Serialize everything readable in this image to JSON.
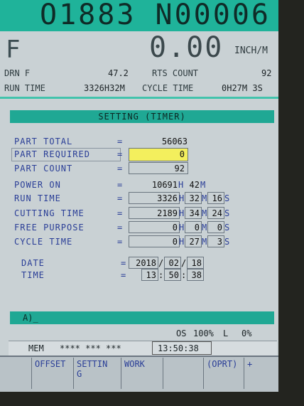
{
  "header": {
    "program_number": "O1883 N00006",
    "mode": "F",
    "feed_value": "0.00",
    "feed_unit": "INCH/M"
  },
  "status": {
    "drn_label": "DRN F",
    "drn_value": "47.2",
    "parts_count_label": "RTS COUNT",
    "parts_count_value": "92",
    "run_time_label": "RUN TIME",
    "run_time_value": "3326H32M",
    "cycle_time_label": "CYCLE TIME",
    "cycle_time_value": "0H27M 3S"
  },
  "panel": {
    "title": "SETTING (TIMER)",
    "rows": {
      "part_total": {
        "label": "PART TOTAL",
        "eq": "=",
        "value": "56063"
      },
      "part_required": {
        "label": "PART REQUIRED",
        "eq": "=",
        "value": "0"
      },
      "part_count": {
        "label": "PART COUNT",
        "eq": "=",
        "value": "92"
      },
      "power_on": {
        "label": "POWER ON",
        "eq": "=",
        "h": "10691",
        "hu": "H",
        "m": "42",
        "mu": "M"
      },
      "run_time": {
        "label": "RUN TIME",
        "eq": "=",
        "h": "3326",
        "hu": "H",
        "m": "32",
        "mu": "M",
        "s": "16",
        "su": "S"
      },
      "cutting_time": {
        "label": "CUTTING TIME",
        "eq": "=",
        "h": "2189",
        "hu": "H",
        "m": "34",
        "mu": "M",
        "s": "24",
        "su": "S"
      },
      "free_purpose": {
        "label": "FREE PURPOSE",
        "eq": "=",
        "h": "0",
        "hu": "H",
        "m": "0",
        "mu": "M",
        "s": "0",
        "su": "S"
      },
      "cycle_time": {
        "label": "CYCLE TIME",
        "eq": "=",
        "h": "0",
        "hu": "H",
        "m": "27",
        "mu": "M",
        "s": "3",
        "su": "S"
      },
      "date": {
        "label": "DATE",
        "eq": "=",
        "y": "2018",
        "mo": "02",
        "d": "18",
        "sep": "/"
      },
      "time": {
        "label": "TIME",
        "eq": "=",
        "h": "13",
        "m": "50",
        "s": "38",
        "sep": ":"
      }
    }
  },
  "input": {
    "prompt": "A)_"
  },
  "statusline": {
    "os_label": "OS",
    "os_value": "100%",
    "l_label": "L",
    "l_value": "0%"
  },
  "membar": {
    "mode": "MEM",
    "stars": "**** *** ***",
    "clock": "13:50:38"
  },
  "softkeys": [
    "OFFSET",
    "SETTIN G",
    "WORK",
    "",
    "(OPRT)",
    "+"
  ]
}
